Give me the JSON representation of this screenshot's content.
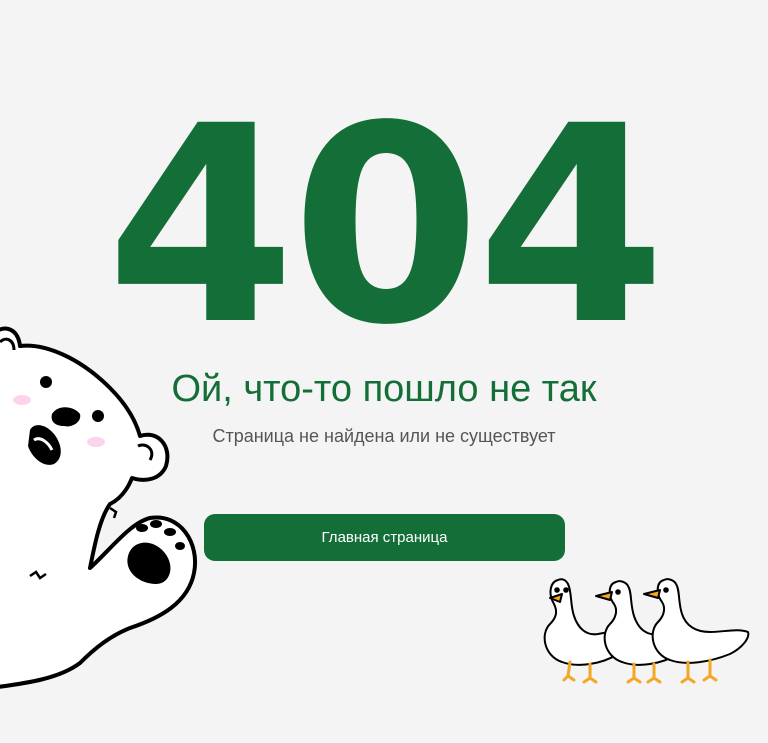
{
  "error": {
    "code": "404",
    "title": "Ой, что-то пошло не так",
    "subtitle": "Страница не найдена или не существует"
  },
  "actions": {
    "home_label": "Главная страница"
  },
  "colors": {
    "brand": "#146e37",
    "background": "#f4f4f4",
    "subtitle_text": "#555555",
    "duck_beak": "#f5a623"
  },
  "illustrations": {
    "left": "polar-bear-icon",
    "right": "ducks-icon"
  }
}
